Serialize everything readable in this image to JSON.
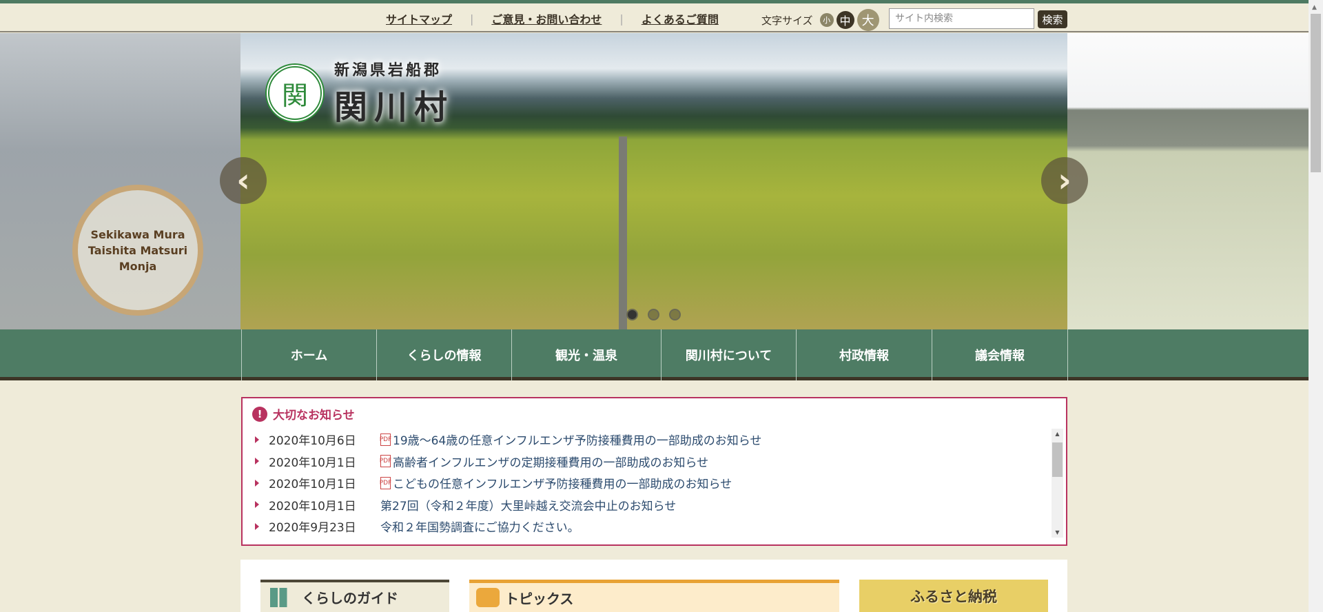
{
  "header": {
    "links": [
      "サイトマップ",
      "ご意見・お問い合わせ",
      "よくあるご質問"
    ],
    "font_size_label": "文字サイズ",
    "font_sizes": [
      "小",
      "中",
      "大"
    ],
    "search_placeholder": "サイト内検索",
    "search_button": "検索"
  },
  "banner": {
    "logo_pref": "新潟県岩船郡",
    "logo_village": "関川村",
    "emblem_glyph": "関",
    "side_festival_text": [
      "Sekikawa Mura",
      "Taishita Matsuri",
      "Monja"
    ],
    "prev_icon": "‹",
    "next_icon": "›",
    "slide_count": 3,
    "active_slide": 1
  },
  "nav": {
    "items": [
      "ホーム",
      "くらしの情報",
      "観光・温泉",
      "関川村について",
      "村政情報",
      "議会情報"
    ]
  },
  "notice": {
    "title": "大切なお知らせ",
    "items": [
      {
        "date": "2020年10月6日",
        "text": "19歳～64歳の任意インフルエンザ予防接種費用の一部助成のお知らせ",
        "pdf": true
      },
      {
        "date": "2020年10月1日",
        "text": "高齢者インフルエンザの定期接種費用の一部助成のお知らせ",
        "pdf": true
      },
      {
        "date": "2020年10月1日",
        "text": "こどもの任意インフルエンザ予防接種費用の一部助成のお知らせ",
        "pdf": true
      },
      {
        "date": "2020年10月1日",
        "text": "第27回（令和２年度）大里峠越え交流会中止のお知らせ",
        "pdf": false
      },
      {
        "date": "2020年9月23日",
        "text": "令和２年国勢調査にご協力ください。",
        "pdf": false
      }
    ]
  },
  "sections": {
    "guide": "くらしのガイド",
    "topics": "トピックス",
    "furusato": "ふるさと納税"
  },
  "colors": {
    "nav_green": "#4e7c64",
    "notice_accent": "#b8325f",
    "topics_orange": "#e8a234"
  }
}
